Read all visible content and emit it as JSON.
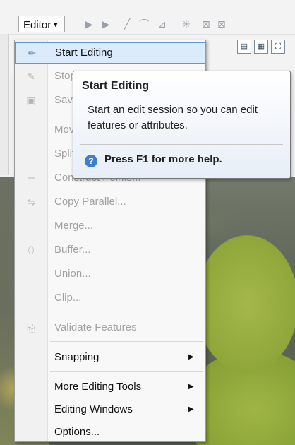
{
  "toolbar": {
    "editor_label": "Editor"
  },
  "menu": {
    "items": [
      {
        "label": "Start Editing",
        "enabled": true,
        "icon": "pencil-icon"
      },
      {
        "label": "Stop Editing",
        "enabled": false,
        "icon": "stop-edit-icon"
      },
      {
        "label": "Save Edits",
        "enabled": false,
        "icon": "save-icon"
      },
      {
        "label": "Move...",
        "enabled": false,
        "icon": ""
      },
      {
        "label": "Split...",
        "enabled": false,
        "icon": ""
      },
      {
        "label": "Construct Points...",
        "enabled": false,
        "icon": "construct-points-icon"
      },
      {
        "label": "Copy Parallel...",
        "enabled": false,
        "icon": "copy-parallel-icon"
      },
      {
        "label": "Merge...",
        "enabled": false,
        "icon": ""
      },
      {
        "label": "Buffer...",
        "enabled": false,
        "icon": "buffer-icon"
      },
      {
        "label": "Union...",
        "enabled": false,
        "icon": ""
      },
      {
        "label": "Clip...",
        "enabled": false,
        "icon": ""
      },
      {
        "label": "Validate Features",
        "enabled": false,
        "icon": "validate-icon"
      },
      {
        "label": "Snapping",
        "enabled": true,
        "submenu": true
      },
      {
        "label": "More Editing Tools",
        "enabled": true,
        "submenu": true
      },
      {
        "label": "Editing Windows",
        "enabled": true,
        "submenu": true
      },
      {
        "label": "Options...",
        "enabled": true
      }
    ]
  },
  "tooltip": {
    "title": "Start Editing",
    "body": "Start an edit session so you can edit features or attributes.",
    "help": "Press F1 for more help."
  },
  "colors": {
    "highlight_bg": "#dcebfb",
    "highlight_border": "#5b9bd5",
    "disabled_text": "#a2a2a2"
  }
}
